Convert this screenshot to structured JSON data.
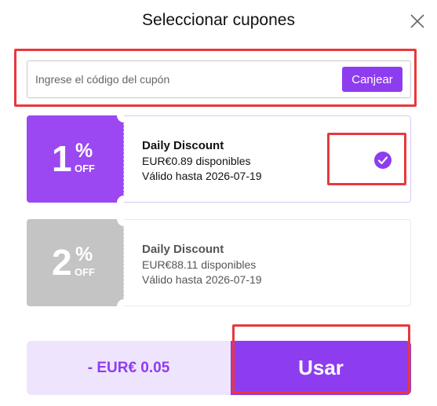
{
  "dialog": {
    "title": "Seleccionar cupones",
    "close_icon": "close-icon"
  },
  "code_entry": {
    "placeholder": "Ingrese el código del cupón",
    "value": "",
    "redeem_label": "Canjear"
  },
  "coupons": [
    {
      "percent": "1",
      "percent_symbol": "%",
      "off_label": "OFF",
      "name": "Daily Discount",
      "available": "EUR€0.89 disponibles",
      "valid_until": "Válido hasta 2026-07-19",
      "selected": true,
      "stub_color": "#9b47f2"
    },
    {
      "percent": "2",
      "percent_symbol": "%",
      "off_label": "OFF",
      "name": "Daily Discount",
      "available": "EUR€88.11 disponibles",
      "valid_until": "Válido hasta 2026-07-19",
      "selected": false,
      "stub_color": "#c4c4c4"
    }
  ],
  "footer": {
    "discount_text": "- EUR€ 0.05",
    "use_label": "Usar"
  },
  "colors": {
    "accent": "#8e3cf0",
    "highlight": "#e8383d",
    "summary_bg": "#efe4fd"
  }
}
